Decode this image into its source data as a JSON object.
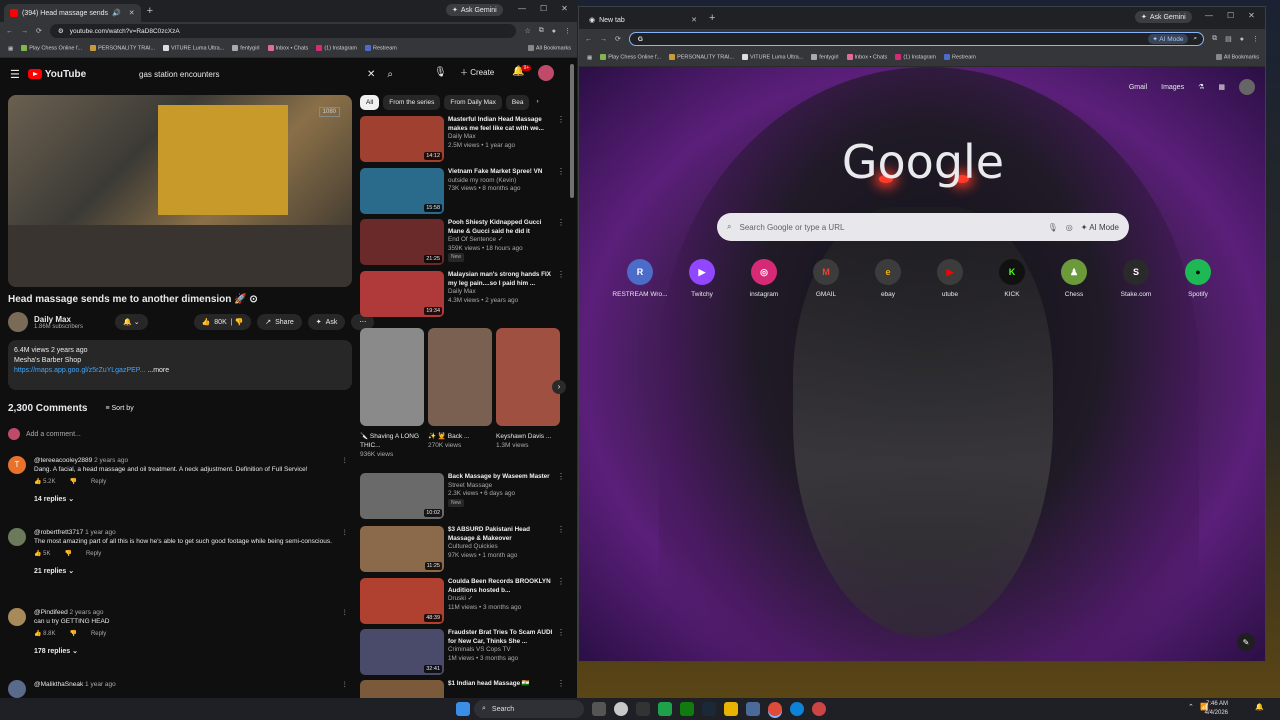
{
  "left_window": {
    "tab_title": "(394) Head massage sends",
    "ask_gemini": "Ask Gemini",
    "url": "youtube.com/watch?v=RaD8C0zcXzA",
    "bookmarks": [
      "Play Chess Online f...",
      "PERSONALITY TRAI...",
      "VITURE Luma Ultra...",
      "fentygirl",
      "Inbox • Chats",
      "(1) Instagram",
      "Restream",
      "All Bookmarks"
    ],
    "youtube": {
      "logo": "YouTube",
      "search_value": "gas station encounters",
      "create": "Create",
      "notif_count": "9+",
      "video_title": "Head massage sends me to another dimension 🚀 ⊙",
      "watermark": "1080",
      "channel_name": "Daily Max",
      "subscribers": "1.86M subscribers",
      "likes": "80K",
      "share": "Share",
      "ask": "Ask",
      "desc_views": "6.4M views  2 years ago",
      "desc_place": "Mesha's Barber Shop",
      "desc_link": "https://maps.app.goo.gl/z5rZuYLgazPEP...",
      "desc_more": "...more",
      "comment_count": "2,300 Comments",
      "sort_by": "Sort by",
      "add_comment": "Add a comment...",
      "comments": [
        {
          "user": "@tereeacooley2889",
          "time": "2 years ago",
          "text": "Dang. A facial, a head massage and oil treatment. A neck adjustment. Definition of Full Service!",
          "likes": "5.2K",
          "reply": "Reply",
          "replies": "14 replies",
          "color": "#e8712c",
          "initial": "T"
        },
        {
          "user": "@robertfrett3717",
          "time": "1 year ago",
          "text": "The most amazing part of all this is how he's able to get such good footage while being semi-conscious.",
          "likes": "5K",
          "reply": "Reply",
          "replies": "21 replies",
          "color": "#6b7a5a",
          "initial": ""
        },
        {
          "user": "@Pindifeed",
          "time": "2 years ago",
          "text": "can u try GETTING HEAD",
          "likes": "8.8K",
          "reply": "Reply",
          "replies": "178 replies",
          "color": "#a88a5a",
          "initial": ""
        },
        {
          "user": "@MalikthaSneak",
          "time": "1 year ago",
          "text": "",
          "likes": "",
          "reply": "",
          "replies": "",
          "color": "#5a6a8a",
          "initial": ""
        }
      ],
      "chips": [
        "All",
        "From the series",
        "From Daily Max",
        "Bea"
      ],
      "recs": [
        {
          "title": "Masterful Indian Head Massage makes me feel like cat with we...",
          "channel": "Daily Max",
          "meta": "2.5M views • 1 year ago",
          "dur": "14:12",
          "color": "#a04030",
          "new": ""
        },
        {
          "title": "Vietnam Fake Market Spree! VN",
          "channel": "outside my room (Kevin)",
          "meta": "73K views • 8 months ago",
          "dur": "15:58",
          "color": "#2a6a8a",
          "new": ""
        },
        {
          "title": "Pooh Shiesty Kidnapped Gucci Mane & Gucci said he did it",
          "channel": "End Of Sentence ✓",
          "meta": "359K views • 18 hours ago",
          "dur": "21:25",
          "color": "#6a2a2a",
          "new": "New"
        },
        {
          "title": "Malaysian man's strong hands FIX my leg pain....so I paid him ...",
          "channel": "Daily Max",
          "meta": "4.3M views • 2 years ago",
          "dur": "19:34",
          "color": "#b03a3a",
          "new": ""
        }
      ],
      "shorts": [
        {
          "title": "🔪 Shaving A LONG THIC...",
          "views": "936K views",
          "color": "#8a8a8a"
        },
        {
          "title": "✨ 💆 Back ...",
          "views": "270K views",
          "color": "#7a6050"
        },
        {
          "title": "Keyshawn Davis ...",
          "views": "1.3M views",
          "color": "#a05040"
        }
      ],
      "recs2": [
        {
          "title": "Back Massage by Waseem Master",
          "channel": "Street Massage",
          "meta": "2.3K views • 6 days ago",
          "dur": "10:02",
          "color": "#6a6a6a",
          "new": "New"
        },
        {
          "title": "$3 ABSURD Pakistani Head Massage & Makeover",
          "channel": "Cultured Quickies",
          "meta": "97K views • 1 month ago",
          "dur": "11:25",
          "color": "#8a6a4a",
          "new": ""
        },
        {
          "title": "Coulda Been Records BROOKLYN Auditions hosted b...",
          "channel": "Druski ✓",
          "meta": "11M views • 3 months ago",
          "dur": "48:39",
          "color": "#b04030",
          "new": ""
        },
        {
          "title": "Fraudster Brat Tries To Scam AUDI for New Car, Thinks She ...",
          "channel": "Criminals VS Cops TV",
          "meta": "1M views • 3 months ago",
          "dur": "32:41",
          "color": "#4a4a6a",
          "new": ""
        },
        {
          "title": "$1 Indian head Massage 🇮🇳",
          "channel": "",
          "meta": "",
          "dur": "",
          "color": "#7a5a3a",
          "new": ""
        }
      ]
    }
  },
  "right_window": {
    "tab_title": "New tab",
    "ask_gemini": "Ask Gemini",
    "ai_mode": "AI Mode",
    "bookmarks": [
      "Play Chess Online f...",
      "PERSONALITY TRAI...",
      "VITURE Luma Ultra...",
      "fentygirl",
      "Inbox • Chats",
      "(1) Instagram",
      "Restream",
      "All Bookmarks"
    ],
    "gmail": "Gmail",
    "images": "Images",
    "logo": "Google",
    "search_placeholder": "Search Google or type a URL",
    "search_ai_mode": "AI Mode",
    "shortcuts": [
      {
        "label": "RESTREAM Wro...",
        "glyph": "R",
        "bg": "#4b6cc8",
        "fg": "#ffffff"
      },
      {
        "label": "Twitchy",
        "glyph": "▶",
        "bg": "#9146ff",
        "fg": "#ffffff"
      },
      {
        "label": "instagram",
        "glyph": "◎",
        "bg": "#d62976",
        "fg": "#ffffff"
      },
      {
        "label": "GMAIL",
        "glyph": "M",
        "bg": "#3c3c3c",
        "fg": "#ea4335"
      },
      {
        "label": "ebay",
        "glyph": "e",
        "bg": "#3c3c3c",
        "fg": "#f5af02"
      },
      {
        "label": "utube",
        "glyph": "▶",
        "bg": "#3c3c3c",
        "fg": "#ff0000"
      },
      {
        "label": "KICK",
        "glyph": "K",
        "bg": "#111111",
        "fg": "#53fc18"
      },
      {
        "label": "Chess",
        "glyph": "♟",
        "bg": "#6a9a3a",
        "fg": "#ffffff"
      },
      {
        "label": "Stake.com",
        "glyph": "S",
        "bg": "#2a2a2a",
        "fg": "#ffffff"
      },
      {
        "label": "Spotify",
        "glyph": "●",
        "bg": "#1db954",
        "fg": "#111111"
      }
    ]
  },
  "taskbar": {
    "search": "Search",
    "time": "7:46 AM",
    "date": "4/4/2026"
  }
}
